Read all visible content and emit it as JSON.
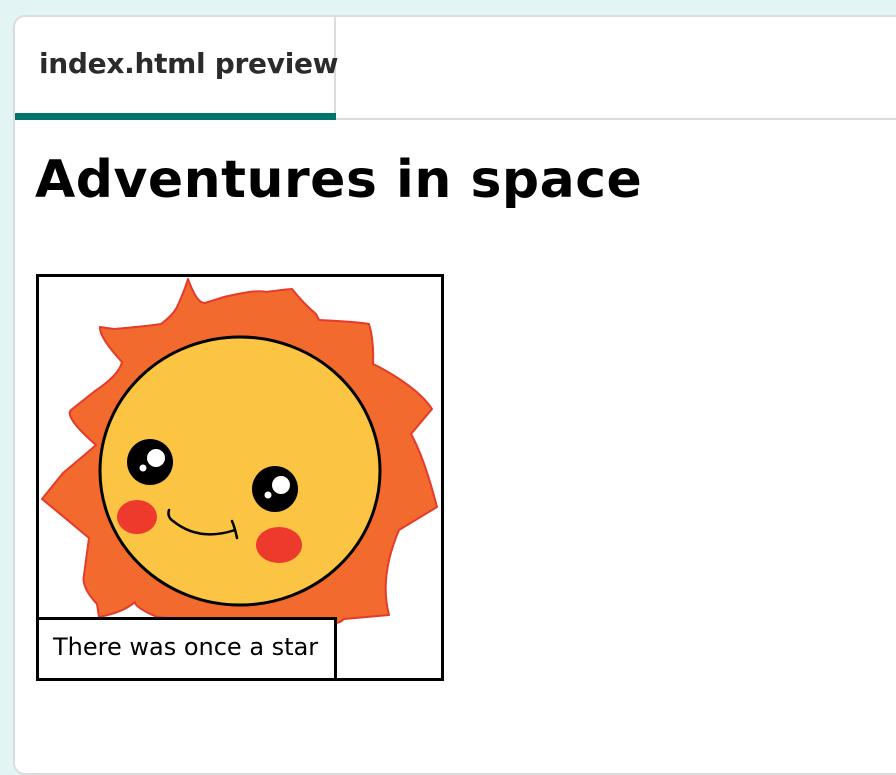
{
  "tab": {
    "label": "index.html preview",
    "active_color": "#00736a"
  },
  "page": {
    "heading": "Adventures in space"
  },
  "comic_panel": {
    "image_icon": "smiling-sun-icon",
    "caption": "There was once a star"
  },
  "colors": {
    "background": "#e2f5f4",
    "sun_face": "#fbc442",
    "sun_rays": "#f26a2e",
    "cheeks": "#ee3a2c"
  }
}
